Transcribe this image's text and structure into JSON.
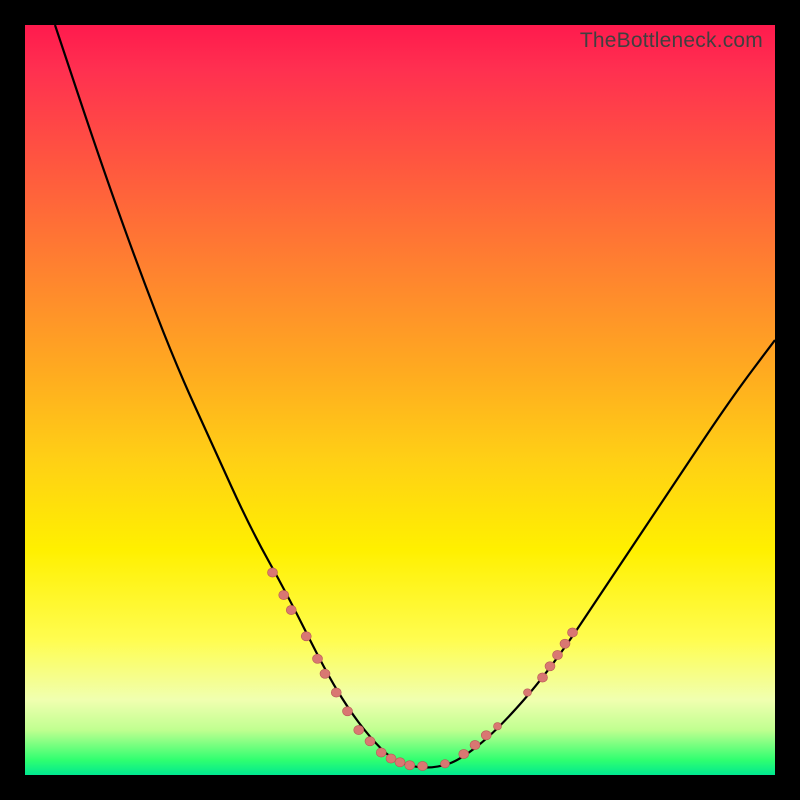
{
  "watermark": "TheBottleneck.com",
  "chart_data": {
    "type": "line",
    "title": "",
    "xlabel": "",
    "ylabel": "",
    "xlim": [
      0,
      100
    ],
    "ylim": [
      0,
      100
    ],
    "grid": false,
    "legend": false,
    "series": [
      {
        "name": "bottleneck-curve",
        "color": "#000000",
        "x": [
          4,
          10,
          15,
          20,
          25,
          30,
          35,
          40,
          43,
          46,
          49,
          52,
          55,
          58,
          63,
          70,
          78,
          86,
          94,
          100
        ],
        "y": [
          100,
          82,
          68,
          55,
          44,
          33,
          24,
          14,
          9,
          5,
          2,
          1,
          1,
          2,
          6,
          14,
          26,
          38,
          50,
          58
        ]
      }
    ],
    "markers": {
      "color": "#d97772",
      "note": "clustered bead markers along curve near minimum and rising limbs",
      "points": [
        {
          "x": 33,
          "y": 27,
          "r": 5
        },
        {
          "x": 34.5,
          "y": 24,
          "r": 5
        },
        {
          "x": 35.5,
          "y": 22,
          "r": 5
        },
        {
          "x": 37.5,
          "y": 18.5,
          "r": 5
        },
        {
          "x": 39,
          "y": 15.5,
          "r": 5
        },
        {
          "x": 40,
          "y": 13.5,
          "r": 5
        },
        {
          "x": 41.5,
          "y": 11,
          "r": 5
        },
        {
          "x": 43,
          "y": 8.5,
          "r": 5
        },
        {
          "x": 44.5,
          "y": 6,
          "r": 5
        },
        {
          "x": 46,
          "y": 4.5,
          "r": 5
        },
        {
          "x": 47.5,
          "y": 3,
          "r": 5
        },
        {
          "x": 48.8,
          "y": 2.2,
          "r": 5
        },
        {
          "x": 50,
          "y": 1.7,
          "r": 5
        },
        {
          "x": 51.3,
          "y": 1.3,
          "r": 5
        },
        {
          "x": 53,
          "y": 1.2,
          "r": 5
        },
        {
          "x": 56,
          "y": 1.5,
          "r": 4.5
        },
        {
          "x": 58.5,
          "y": 2.8,
          "r": 5
        },
        {
          "x": 60,
          "y": 4,
          "r": 5
        },
        {
          "x": 61.5,
          "y": 5.3,
          "r": 5
        },
        {
          "x": 63,
          "y": 6.5,
          "r": 4
        },
        {
          "x": 67,
          "y": 11,
          "r": 4
        },
        {
          "x": 69,
          "y": 13,
          "r": 5
        },
        {
          "x": 70,
          "y": 14.5,
          "r": 5
        },
        {
          "x": 71,
          "y": 16,
          "r": 5
        },
        {
          "x": 72,
          "y": 17.5,
          "r": 5
        },
        {
          "x": 73,
          "y": 19,
          "r": 5
        }
      ]
    },
    "background_gradient": {
      "top_color": "#ff1a4d",
      "bottom_color": "#00e890",
      "stops": [
        "red",
        "orange",
        "yellow",
        "lime",
        "green"
      ]
    }
  }
}
